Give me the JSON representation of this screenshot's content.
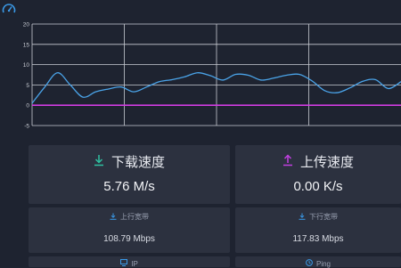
{
  "header": {
    "icon": "speedometer-icon"
  },
  "chart_data": {
    "type": "line",
    "y_ticks": [
      "20",
      "15",
      "10",
      "5",
      "0",
      "-5"
    ],
    "ylim": [
      -5,
      20
    ],
    "grid": true,
    "series": [
      {
        "color": "#4aa3e8",
        "values": [
          0.5,
          4.5,
          8,
          5,
          2,
          3.3,
          4,
          4.5,
          3.3,
          4.5,
          5.8,
          6.3,
          7,
          8,
          7.3,
          6.2,
          7.6,
          7.4,
          6.2,
          6.7,
          7.4,
          7.6,
          6,
          3.6,
          3.1,
          4.3,
          5.9,
          6.3,
          4.1,
          5.8
        ]
      },
      {
        "color": "#d03ce0",
        "values": [
          0,
          0,
          0,
          0,
          0,
          0,
          0,
          0,
          0,
          0,
          0,
          0,
          0,
          0,
          0,
          0,
          0,
          0,
          0,
          0,
          0,
          0,
          0,
          0,
          0,
          0,
          0,
          0,
          0,
          0
        ]
      }
    ]
  },
  "download": {
    "title": "下载速度",
    "value": "5.76 M/s",
    "icon": "download-icon",
    "icon_color": "#2fc0a0"
  },
  "upload": {
    "title": "上传速度",
    "value": "0.00 K/s",
    "icon": "upload-icon",
    "icon_color": "#c13fe0"
  },
  "upload_bandwidth": {
    "label": "上行宽带",
    "value": "108.79 Mbps",
    "icon": "upload-small-icon"
  },
  "download_bandwidth": {
    "label": "下行宽带",
    "value": "117.83 Mbps",
    "icon": "download-small-icon"
  },
  "ip": {
    "label": "IP",
    "icon": "monitor-icon"
  },
  "ping": {
    "label": "Ping",
    "icon": "clock-icon"
  }
}
